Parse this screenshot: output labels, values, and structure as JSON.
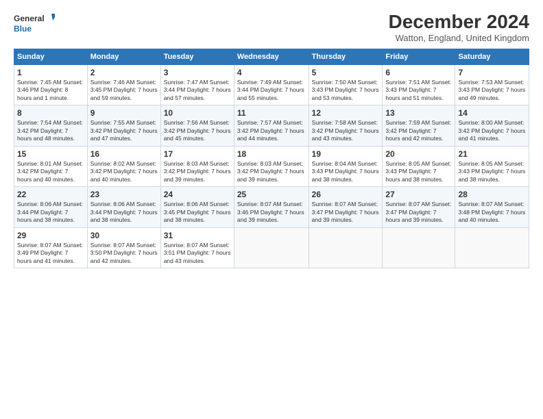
{
  "logo": {
    "line1": "General",
    "line2": "Blue"
  },
  "title": "December 2024",
  "subtitle": "Watton, England, United Kingdom",
  "days_header": [
    "Sunday",
    "Monday",
    "Tuesday",
    "Wednesday",
    "Thursday",
    "Friday",
    "Saturday"
  ],
  "weeks": [
    [
      {
        "day": "1",
        "info": "Sunrise: 7:45 AM\nSunset: 3:46 PM\nDaylight: 8 hours and 1 minute."
      },
      {
        "day": "2",
        "info": "Sunrise: 7:46 AM\nSunset: 3:45 PM\nDaylight: 7 hours and 59 minutes."
      },
      {
        "day": "3",
        "info": "Sunrise: 7:47 AM\nSunset: 3:44 PM\nDaylight: 7 hours and 57 minutes."
      },
      {
        "day": "4",
        "info": "Sunrise: 7:49 AM\nSunset: 3:44 PM\nDaylight: 7 hours and 55 minutes."
      },
      {
        "day": "5",
        "info": "Sunrise: 7:50 AM\nSunset: 3:43 PM\nDaylight: 7 hours and 53 minutes."
      },
      {
        "day": "6",
        "info": "Sunrise: 7:51 AM\nSunset: 3:43 PM\nDaylight: 7 hours and 51 minutes."
      },
      {
        "day": "7",
        "info": "Sunrise: 7:53 AM\nSunset: 3:43 PM\nDaylight: 7 hours and 49 minutes."
      }
    ],
    [
      {
        "day": "8",
        "info": "Sunrise: 7:54 AM\nSunset: 3:42 PM\nDaylight: 7 hours and 48 minutes."
      },
      {
        "day": "9",
        "info": "Sunrise: 7:55 AM\nSunset: 3:42 PM\nDaylight: 7 hours and 47 minutes."
      },
      {
        "day": "10",
        "info": "Sunrise: 7:56 AM\nSunset: 3:42 PM\nDaylight: 7 hours and 45 minutes."
      },
      {
        "day": "11",
        "info": "Sunrise: 7:57 AM\nSunset: 3:42 PM\nDaylight: 7 hours and 44 minutes."
      },
      {
        "day": "12",
        "info": "Sunrise: 7:58 AM\nSunset: 3:42 PM\nDaylight: 7 hours and 43 minutes."
      },
      {
        "day": "13",
        "info": "Sunrise: 7:59 AM\nSunset: 3:42 PM\nDaylight: 7 hours and 42 minutes."
      },
      {
        "day": "14",
        "info": "Sunrise: 8:00 AM\nSunset: 3:42 PM\nDaylight: 7 hours and 41 minutes."
      }
    ],
    [
      {
        "day": "15",
        "info": "Sunrise: 8:01 AM\nSunset: 3:42 PM\nDaylight: 7 hours and 40 minutes."
      },
      {
        "day": "16",
        "info": "Sunrise: 8:02 AM\nSunset: 3:42 PM\nDaylight: 7 hours and 40 minutes."
      },
      {
        "day": "17",
        "info": "Sunrise: 8:03 AM\nSunset: 3:42 PM\nDaylight: 7 hours and 39 minutes."
      },
      {
        "day": "18",
        "info": "Sunrise: 8:03 AM\nSunset: 3:42 PM\nDaylight: 7 hours and 39 minutes."
      },
      {
        "day": "19",
        "info": "Sunrise: 8:04 AM\nSunset: 3:43 PM\nDaylight: 7 hours and 38 minutes."
      },
      {
        "day": "20",
        "info": "Sunrise: 8:05 AM\nSunset: 3:43 PM\nDaylight: 7 hours and 38 minutes."
      },
      {
        "day": "21",
        "info": "Sunrise: 8:05 AM\nSunset: 3:43 PM\nDaylight: 7 hours and 38 minutes."
      }
    ],
    [
      {
        "day": "22",
        "info": "Sunrise: 8:06 AM\nSunset: 3:44 PM\nDaylight: 7 hours and 38 minutes."
      },
      {
        "day": "23",
        "info": "Sunrise: 8:06 AM\nSunset: 3:44 PM\nDaylight: 7 hours and 38 minutes."
      },
      {
        "day": "24",
        "info": "Sunrise: 8:06 AM\nSunset: 3:45 PM\nDaylight: 7 hours and 38 minutes."
      },
      {
        "day": "25",
        "info": "Sunrise: 8:07 AM\nSunset: 3:46 PM\nDaylight: 7 hours and 39 minutes."
      },
      {
        "day": "26",
        "info": "Sunrise: 8:07 AM\nSunset: 3:47 PM\nDaylight: 7 hours and 39 minutes."
      },
      {
        "day": "27",
        "info": "Sunrise: 8:07 AM\nSunset: 3:47 PM\nDaylight: 7 hours and 39 minutes."
      },
      {
        "day": "28",
        "info": "Sunrise: 8:07 AM\nSunset: 3:48 PM\nDaylight: 7 hours and 40 minutes."
      }
    ],
    [
      {
        "day": "29",
        "info": "Sunrise: 8:07 AM\nSunset: 3:49 PM\nDaylight: 7 hours and 41 minutes."
      },
      {
        "day": "30",
        "info": "Sunrise: 8:07 AM\nSunset: 3:50 PM\nDaylight: 7 hours and 42 minutes."
      },
      {
        "day": "31",
        "info": "Sunrise: 8:07 AM\nSunset: 3:51 PM\nDaylight: 7 hours and 43 minutes."
      },
      null,
      null,
      null,
      null
    ]
  ]
}
